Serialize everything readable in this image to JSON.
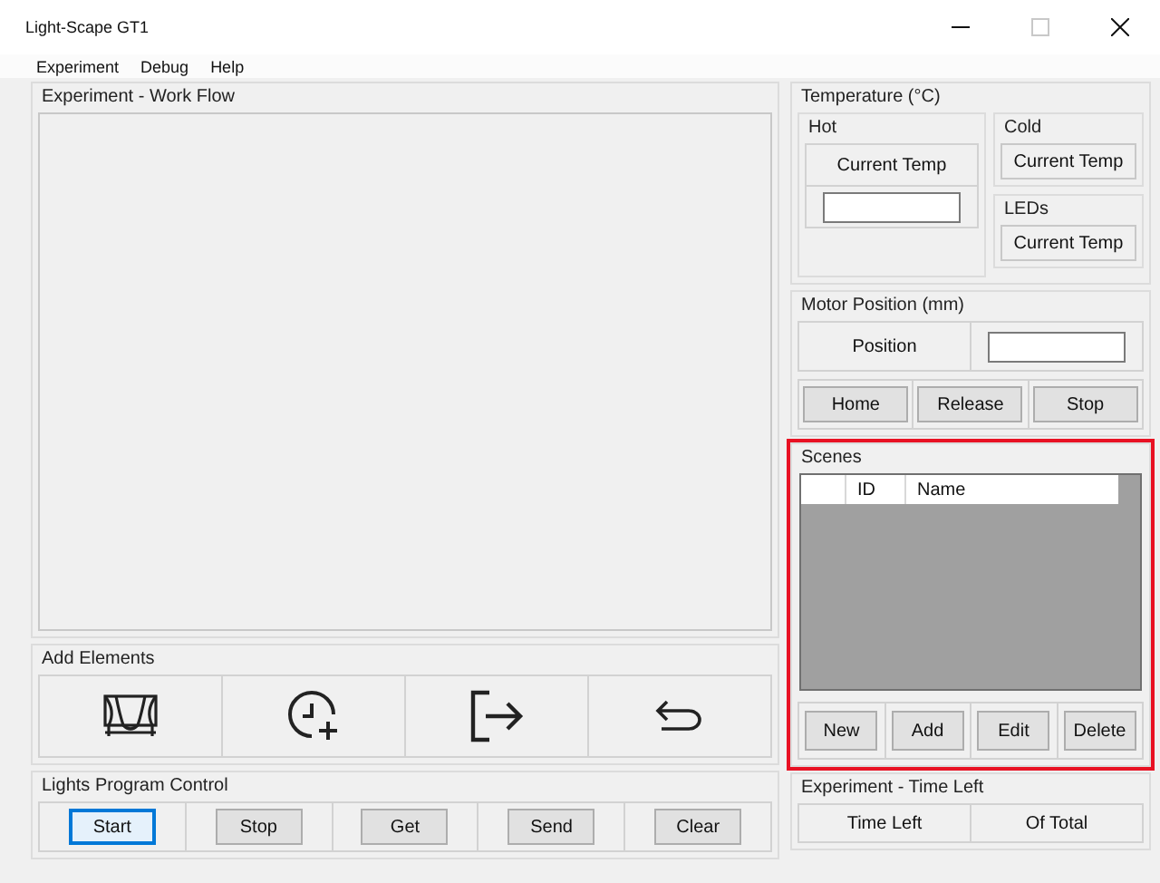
{
  "window": {
    "title": "Light-Scape GT1",
    "maximize_enabled": false
  },
  "menu": [
    "Experiment",
    "Debug",
    "Help"
  ],
  "workflow": {
    "title": "Experiment - Work Flow"
  },
  "add_elements": {
    "title": "Add Elements",
    "tools": [
      {
        "kind": "curtain"
      },
      {
        "kind": "clock_add"
      },
      {
        "kind": "exit"
      },
      {
        "kind": "undo"
      }
    ]
  },
  "lights_control": {
    "title": "Lights Program Control",
    "buttons": [
      {
        "label": "Start",
        "focused": true
      },
      {
        "label": "Stop",
        "focused": false
      },
      {
        "label": "Get",
        "focused": false
      },
      {
        "label": "Send",
        "focused": false
      },
      {
        "label": "Clear",
        "focused": false
      }
    ]
  },
  "temperature": {
    "title": "Temperature (°C)",
    "hot": {
      "title": "Hot",
      "label": "Current Temp"
    },
    "cold": {
      "title": "Cold",
      "label": "Current Temp"
    },
    "leds": {
      "title": "LEDs",
      "label": "Current Temp"
    }
  },
  "motor": {
    "title": "Motor Position (mm)",
    "label": "Position",
    "buttons": [
      "Home",
      "Release",
      "Stop"
    ]
  },
  "scenes": {
    "title": "Scenes",
    "highlighted": true,
    "columns": [
      "ID",
      "Name"
    ],
    "buttons": [
      "New",
      "Add",
      "Edit",
      "Delete"
    ]
  },
  "time_left": {
    "title": "Experiment - Time Left",
    "cells": [
      "Time Left",
      "Of Total"
    ]
  }
}
